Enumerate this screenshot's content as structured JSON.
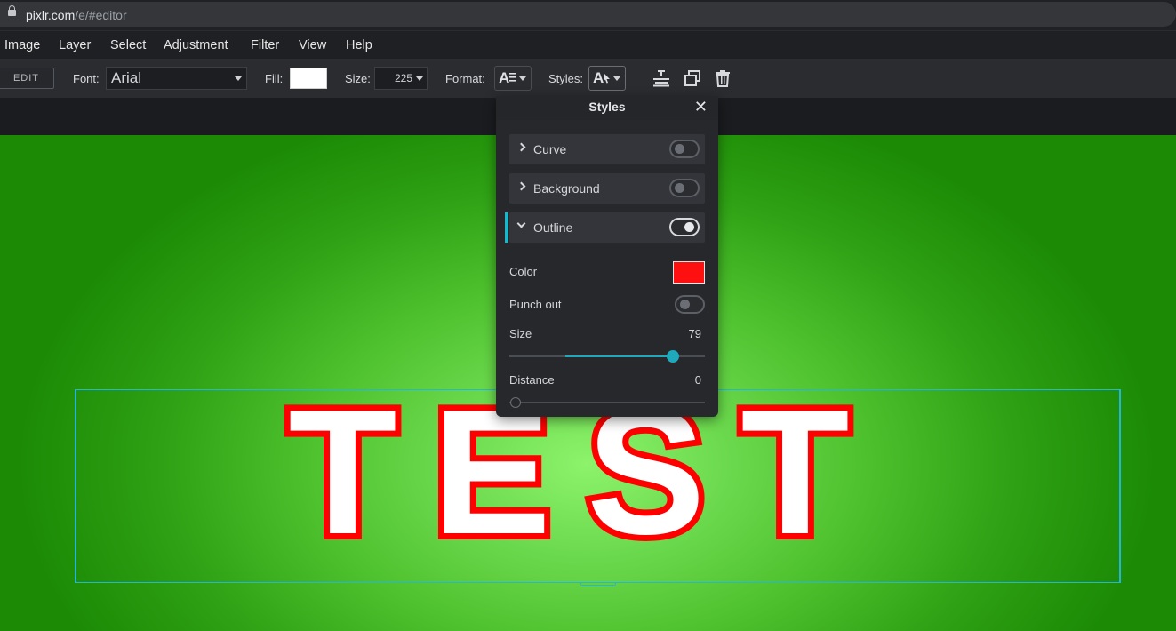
{
  "browser": {
    "url_host": "pixlr.com",
    "url_path": "/e/#editor"
  },
  "menu": [
    "Image",
    "Layer",
    "Select",
    "Adjustment",
    "Filter",
    "View",
    "Help"
  ],
  "toolbar": {
    "edit_label": "EDIT",
    "font_label": "Font:",
    "font_value": "Arial",
    "fill_label": "Fill:",
    "fill_color": "#ffffff",
    "size_label": "Size:",
    "size_value": "225",
    "format_label": "Format:",
    "styles_label": "Styles:"
  },
  "styles_panel": {
    "title": "Styles",
    "close": "✕",
    "sections": [
      {
        "label": "Curve",
        "expanded": false,
        "enabled": false
      },
      {
        "label": "Background",
        "expanded": false,
        "enabled": false
      },
      {
        "label": "Outline",
        "expanded": true,
        "enabled": true
      }
    ],
    "outline": {
      "color_label": "Color",
      "color_value": "#ff1010",
      "punch_label": "Punch out",
      "punch_enabled": false,
      "size_label": "Size",
      "size_value": "79",
      "distance_label": "Distance",
      "distance_value": "0"
    }
  },
  "canvas": {
    "text": "TEST",
    "fill_color": "#ffffff",
    "outline_color": "#ff0000",
    "background": "green radial gradient"
  }
}
